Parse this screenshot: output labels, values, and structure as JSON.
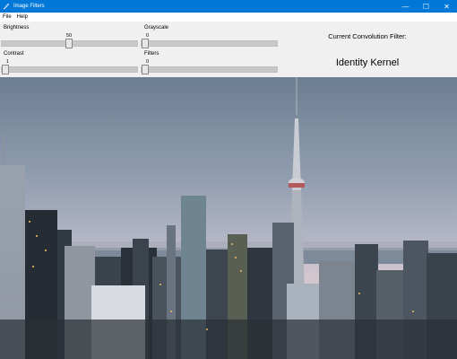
{
  "window": {
    "title": "Image Filters",
    "minimize": "—",
    "maximize": "☐",
    "close": "✕"
  },
  "menu": {
    "items": [
      "File",
      "Help"
    ]
  },
  "sliders": {
    "brightness": {
      "label": "Brightness",
      "value": "50",
      "fraction": 0.5
    },
    "grayscale": {
      "label": "Grayscale",
      "value": "0",
      "fraction": 0.0
    },
    "contrast": {
      "label": "Contrast",
      "value": "1",
      "fraction": 0.0
    },
    "filters": {
      "label": "Filters",
      "value": "0",
      "fraction": 0.0
    }
  },
  "filter_panel": {
    "heading": "Current Convolution Filter:",
    "current": "Identity Kernel"
  },
  "image": {
    "description_icon": "city-skyline-photo"
  },
  "colors": {
    "titlebar": "#0078d7",
    "sky_top": "#6f8194",
    "sky_bottom": "#cfc7d0"
  }
}
